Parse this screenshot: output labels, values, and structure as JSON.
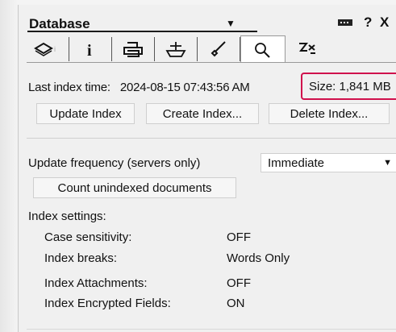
{
  "header": {
    "database_label": "Database",
    "help_glyph": "?",
    "close_glyph": "X"
  },
  "tabs": [
    {
      "icon": "layers-icon"
    },
    {
      "icon": "info-icon"
    },
    {
      "icon": "printer-icon"
    },
    {
      "icon": "ship-icon"
    },
    {
      "icon": "brush-icon"
    },
    {
      "icon": "search-icon",
      "active": true
    },
    {
      "icon": "people-icon"
    }
  ],
  "index": {
    "last_index_label": "Last index time:",
    "last_index_time": "2024-08-15 07:43:56 AM",
    "size_text": "Size: 1,841 MB",
    "update_button": "Update Index",
    "create_button": "Create Index...",
    "delete_button": "Delete Index..."
  },
  "settings": {
    "update_frequency_label": "Update frequency (servers only)",
    "update_frequency_value": "Immediate",
    "count_button": "Count unindexed documents",
    "index_settings_label": "Index settings:",
    "rows": [
      {
        "label": "Case sensitivity:",
        "value": "OFF"
      },
      {
        "label": "Index breaks:",
        "value": "Words Only"
      },
      {
        "label": "Index Attachments:",
        "value": "OFF"
      },
      {
        "label": "Index Encrypted Fields:",
        "value": "ON"
      }
    ]
  },
  "colors": {
    "size_highlight": "#d0104c",
    "panel_bg": "#f0f0f0"
  }
}
